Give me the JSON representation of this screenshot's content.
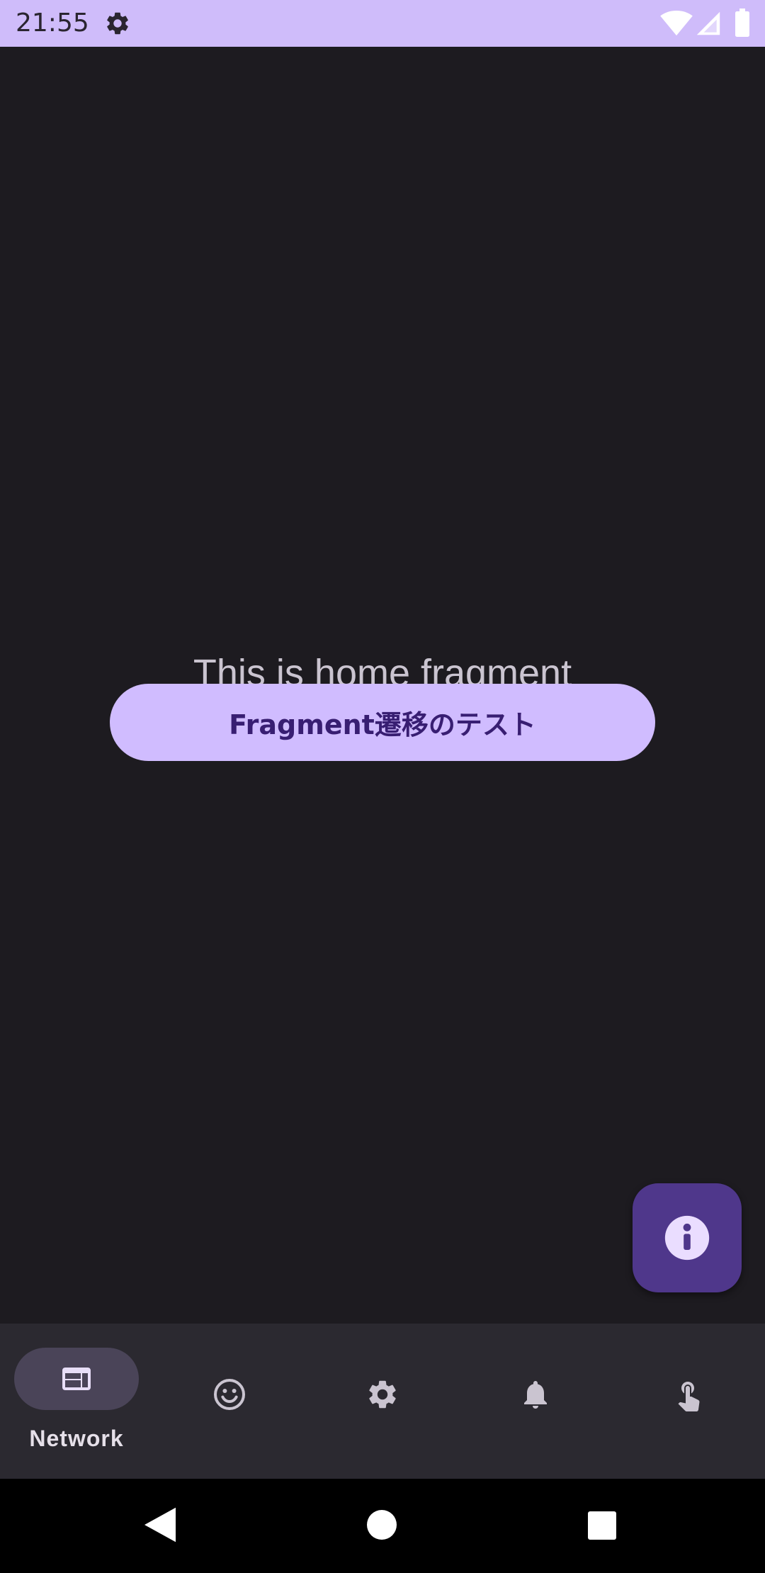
{
  "status_bar": {
    "time": "21:55",
    "icons": [
      "gear-icon",
      "wifi-icon",
      "signal-icon",
      "battery-icon"
    ]
  },
  "main": {
    "text": "This is home fragment",
    "button_label": "Fragment遷移のテスト"
  },
  "fab": {
    "icon": "info-icon"
  },
  "bottom_nav": {
    "items": [
      {
        "label": "Network",
        "icon": "network-icon",
        "selected": true
      },
      {
        "label": "",
        "icon": "smiley-icon",
        "selected": false
      },
      {
        "label": "",
        "icon": "settings-icon",
        "selected": false
      },
      {
        "label": "",
        "icon": "bell-icon",
        "selected": false
      },
      {
        "label": "",
        "icon": "touch-icon",
        "selected": false
      }
    ]
  },
  "system_nav": {
    "icons": [
      "back-icon",
      "home-icon",
      "recents-icon"
    ]
  },
  "colors": {
    "status_bar": "#cfbcfa",
    "background": "#1d1b20",
    "button": "#d0bcff",
    "button_text": "#381e72",
    "fab": "#4f378b",
    "bottom_nav": "#2b2930",
    "active_pill": "#4a4458"
  }
}
